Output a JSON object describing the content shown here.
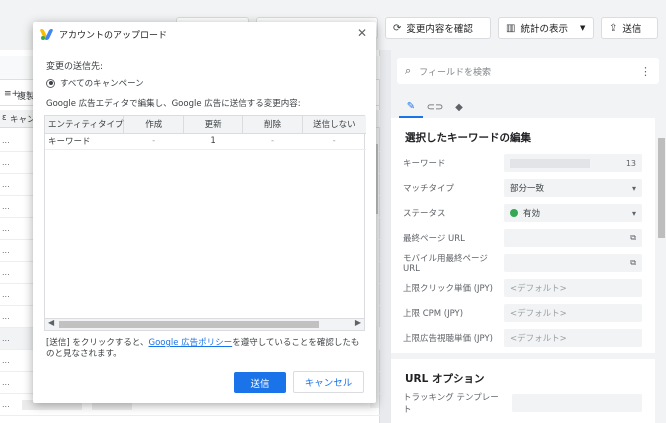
{
  "toolbar": {
    "review_label": "変更内容を確認",
    "stats_label": "統計の表示",
    "send_label": "送信"
  },
  "right_panel": {
    "search_placeholder": "フィールドを検索",
    "section_title": "選択したキーワードの編集",
    "fields": [
      {
        "label": "キーワード",
        "value": "",
        "count": "13"
      },
      {
        "label": "マッチタイプ",
        "value": "部分一致"
      },
      {
        "label": "ステータス",
        "value": "有効"
      },
      {
        "label": "最終ページ URL",
        "value": ""
      },
      {
        "label": "モバイル用最終ページ URL",
        "value": ""
      },
      {
        "label": "上限クリック単価 (JPY)",
        "placeholder": "<デフォルト>"
      },
      {
        "label": "上限 CPM (JPY)",
        "placeholder": "<デフォルト>"
      },
      {
        "label": "上限広告視聴単価 (JPY)",
        "placeholder": "<デフォルト>"
      }
    ],
    "url_section_title": "URL オプション",
    "tracking_label": "トラッキング テンプレート"
  },
  "left_pane": {
    "copy_label": "複製",
    "col_label": "キャン"
  },
  "dialog": {
    "title": "アカウントのアップロード",
    "destination_label": "変更の送信先:",
    "radio_label": "すべてのキャンペーン",
    "description": "Google 広告エディタで編集し、Google 広告に送信する変更内容:",
    "table": {
      "headers": [
        "エンティティタイプ",
        "作成",
        "更新",
        "削除",
        "送信しない"
      ],
      "rows": [
        [
          "キーワード",
          "-",
          "1",
          "-",
          "-"
        ]
      ]
    },
    "notice_before": "[送信] をクリックすると、",
    "notice_link": "Google 広告ポリシー",
    "notice_after": "を遵守していることを確認したものと見なされます。",
    "send_button": "送信",
    "cancel_button": "キャンセル"
  }
}
